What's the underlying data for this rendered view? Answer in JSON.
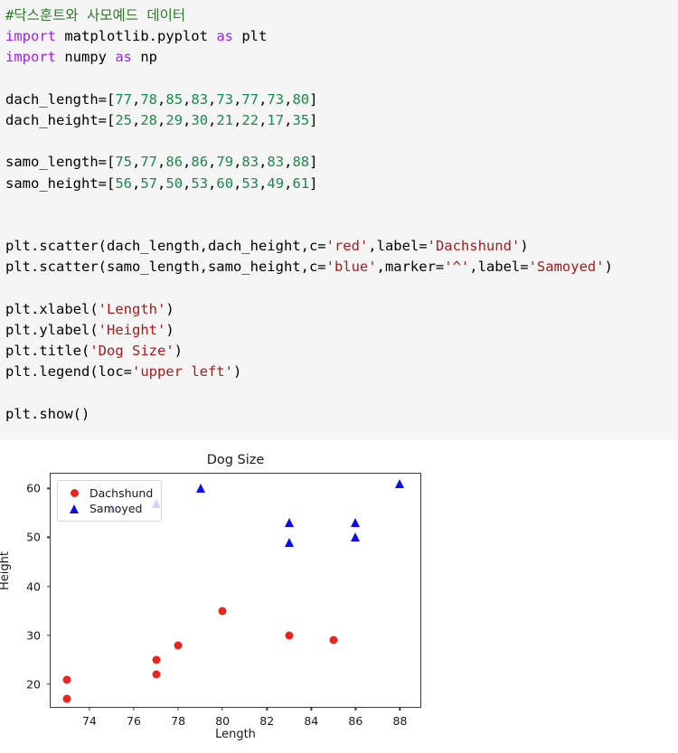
{
  "code_cell": {
    "background": "#f5f5f5",
    "lines": [
      [
        {
          "t": "#닥스훈트와 사모예드 데이터",
          "c": "tok-comment"
        }
      ],
      [
        {
          "t": "import",
          "c": "tok-kw"
        },
        {
          "t": " matplotlib.pyplot ",
          "c": "tok-plain"
        },
        {
          "t": "as",
          "c": "tok-kw"
        },
        {
          "t": " plt",
          "c": "tok-plain"
        }
      ],
      [
        {
          "t": "import",
          "c": "tok-kw"
        },
        {
          "t": " numpy ",
          "c": "tok-plain"
        },
        {
          "t": "as",
          "c": "tok-kw"
        },
        {
          "t": " np",
          "c": "tok-plain"
        }
      ],
      [],
      [
        {
          "t": "dach_length=[",
          "c": "tok-plain"
        },
        {
          "t": "77",
          "c": "tok-num"
        },
        {
          "t": ",",
          "c": "tok-plain"
        },
        {
          "t": "78",
          "c": "tok-num"
        },
        {
          "t": ",",
          "c": "tok-plain"
        },
        {
          "t": "85",
          "c": "tok-num"
        },
        {
          "t": ",",
          "c": "tok-plain"
        },
        {
          "t": "83",
          "c": "tok-num"
        },
        {
          "t": ",",
          "c": "tok-plain"
        },
        {
          "t": "73",
          "c": "tok-num"
        },
        {
          "t": ",",
          "c": "tok-plain"
        },
        {
          "t": "77",
          "c": "tok-num"
        },
        {
          "t": ",",
          "c": "tok-plain"
        },
        {
          "t": "73",
          "c": "tok-num"
        },
        {
          "t": ",",
          "c": "tok-plain"
        },
        {
          "t": "80",
          "c": "tok-num"
        },
        {
          "t": "]",
          "c": "tok-plain"
        }
      ],
      [
        {
          "t": "dach_height=[",
          "c": "tok-plain"
        },
        {
          "t": "25",
          "c": "tok-num"
        },
        {
          "t": ",",
          "c": "tok-plain"
        },
        {
          "t": "28",
          "c": "tok-num"
        },
        {
          "t": ",",
          "c": "tok-plain"
        },
        {
          "t": "29",
          "c": "tok-num"
        },
        {
          "t": ",",
          "c": "tok-plain"
        },
        {
          "t": "30",
          "c": "tok-num"
        },
        {
          "t": ",",
          "c": "tok-plain"
        },
        {
          "t": "21",
          "c": "tok-num"
        },
        {
          "t": ",",
          "c": "tok-plain"
        },
        {
          "t": "22",
          "c": "tok-num"
        },
        {
          "t": ",",
          "c": "tok-plain"
        },
        {
          "t": "17",
          "c": "tok-num"
        },
        {
          "t": ",",
          "c": "tok-plain"
        },
        {
          "t": "35",
          "c": "tok-num"
        },
        {
          "t": "]",
          "c": "tok-plain"
        }
      ],
      [],
      [
        {
          "t": "samo_length=[",
          "c": "tok-plain"
        },
        {
          "t": "75",
          "c": "tok-num"
        },
        {
          "t": ",",
          "c": "tok-plain"
        },
        {
          "t": "77",
          "c": "tok-num"
        },
        {
          "t": ",",
          "c": "tok-plain"
        },
        {
          "t": "86",
          "c": "tok-num"
        },
        {
          "t": ",",
          "c": "tok-plain"
        },
        {
          "t": "86",
          "c": "tok-num"
        },
        {
          "t": ",",
          "c": "tok-plain"
        },
        {
          "t": "79",
          "c": "tok-num"
        },
        {
          "t": ",",
          "c": "tok-plain"
        },
        {
          "t": "83",
          "c": "tok-num"
        },
        {
          "t": ",",
          "c": "tok-plain"
        },
        {
          "t": "83",
          "c": "tok-num"
        },
        {
          "t": ",",
          "c": "tok-plain"
        },
        {
          "t": "88",
          "c": "tok-num"
        },
        {
          "t": "]",
          "c": "tok-plain"
        }
      ],
      [
        {
          "t": "samo_height=[",
          "c": "tok-plain"
        },
        {
          "t": "56",
          "c": "tok-num"
        },
        {
          "t": ",",
          "c": "tok-plain"
        },
        {
          "t": "57",
          "c": "tok-num"
        },
        {
          "t": ",",
          "c": "tok-plain"
        },
        {
          "t": "50",
          "c": "tok-num"
        },
        {
          "t": ",",
          "c": "tok-plain"
        },
        {
          "t": "53",
          "c": "tok-num"
        },
        {
          "t": ",",
          "c": "tok-plain"
        },
        {
          "t": "60",
          "c": "tok-num"
        },
        {
          "t": ",",
          "c": "tok-plain"
        },
        {
          "t": "53",
          "c": "tok-num"
        },
        {
          "t": ",",
          "c": "tok-plain"
        },
        {
          "t": "49",
          "c": "tok-num"
        },
        {
          "t": ",",
          "c": "tok-plain"
        },
        {
          "t": "61",
          "c": "tok-num"
        },
        {
          "t": "]",
          "c": "tok-plain"
        }
      ],
      [],
      [],
      [
        {
          "t": "plt.scatter(dach_length,dach_height,c=",
          "c": "tok-plain"
        },
        {
          "t": "'red'",
          "c": "tok-str"
        },
        {
          "t": ",label=",
          "c": "tok-plain"
        },
        {
          "t": "'Dachshund'",
          "c": "tok-str"
        },
        {
          "t": ")",
          "c": "tok-plain"
        }
      ],
      [
        {
          "t": "plt.scatter(samo_length,samo_height,c=",
          "c": "tok-plain"
        },
        {
          "t": "'blue'",
          "c": "tok-str"
        },
        {
          "t": ",marker=",
          "c": "tok-plain"
        },
        {
          "t": "'^'",
          "c": "tok-str"
        },
        {
          "t": ",label=",
          "c": "tok-plain"
        },
        {
          "t": "'Samoyed'",
          "c": "tok-str"
        },
        {
          "t": ")",
          "c": "tok-plain"
        }
      ],
      [],
      [
        {
          "t": "plt.xlabel(",
          "c": "tok-plain"
        },
        {
          "t": "'Length'",
          "c": "tok-str"
        },
        {
          "t": ")",
          "c": "tok-plain"
        }
      ],
      [
        {
          "t": "plt.ylabel(",
          "c": "tok-plain"
        },
        {
          "t": "'Height'",
          "c": "tok-str"
        },
        {
          "t": ")",
          "c": "tok-plain"
        }
      ],
      [
        {
          "t": "plt.title(",
          "c": "tok-plain"
        },
        {
          "t": "'Dog Size'",
          "c": "tok-str"
        },
        {
          "t": ")",
          "c": "tok-plain"
        }
      ],
      [
        {
          "t": "plt.legend(loc=",
          "c": "tok-plain"
        },
        {
          "t": "'upper left'",
          "c": "tok-str"
        },
        {
          "t": ")",
          "c": "tok-plain"
        }
      ],
      [],
      [
        {
          "t": "plt.show()",
          "c": "tok-plain"
        }
      ]
    ]
  },
  "chart_data": {
    "type": "scatter",
    "title": "Dog Size",
    "xlabel": "Length",
    "ylabel": "Height",
    "xlim": [
      72.25,
      89.0
    ],
    "ylim": [
      15.0,
      63.0
    ],
    "xticks": [
      74,
      76,
      78,
      80,
      82,
      84,
      86,
      88
    ],
    "yticks": [
      20,
      30,
      40,
      50,
      60
    ],
    "grid": false,
    "legend_position": "upper left",
    "series": [
      {
        "name": "Dachshund",
        "color": "#e8251f",
        "marker": "circle",
        "x": [
          77,
          78,
          85,
          83,
          73,
          77,
          73,
          80
        ],
        "y": [
          25,
          28,
          29,
          30,
          21,
          22,
          17,
          35
        ]
      },
      {
        "name": "Samoyed",
        "color": "#0c0cf0",
        "marker": "triangle",
        "x": [
          75,
          77,
          86,
          86,
          79,
          83,
          83,
          88
        ],
        "y": [
          56,
          57,
          50,
          53,
          60,
          53,
          49,
          61
        ]
      }
    ]
  }
}
